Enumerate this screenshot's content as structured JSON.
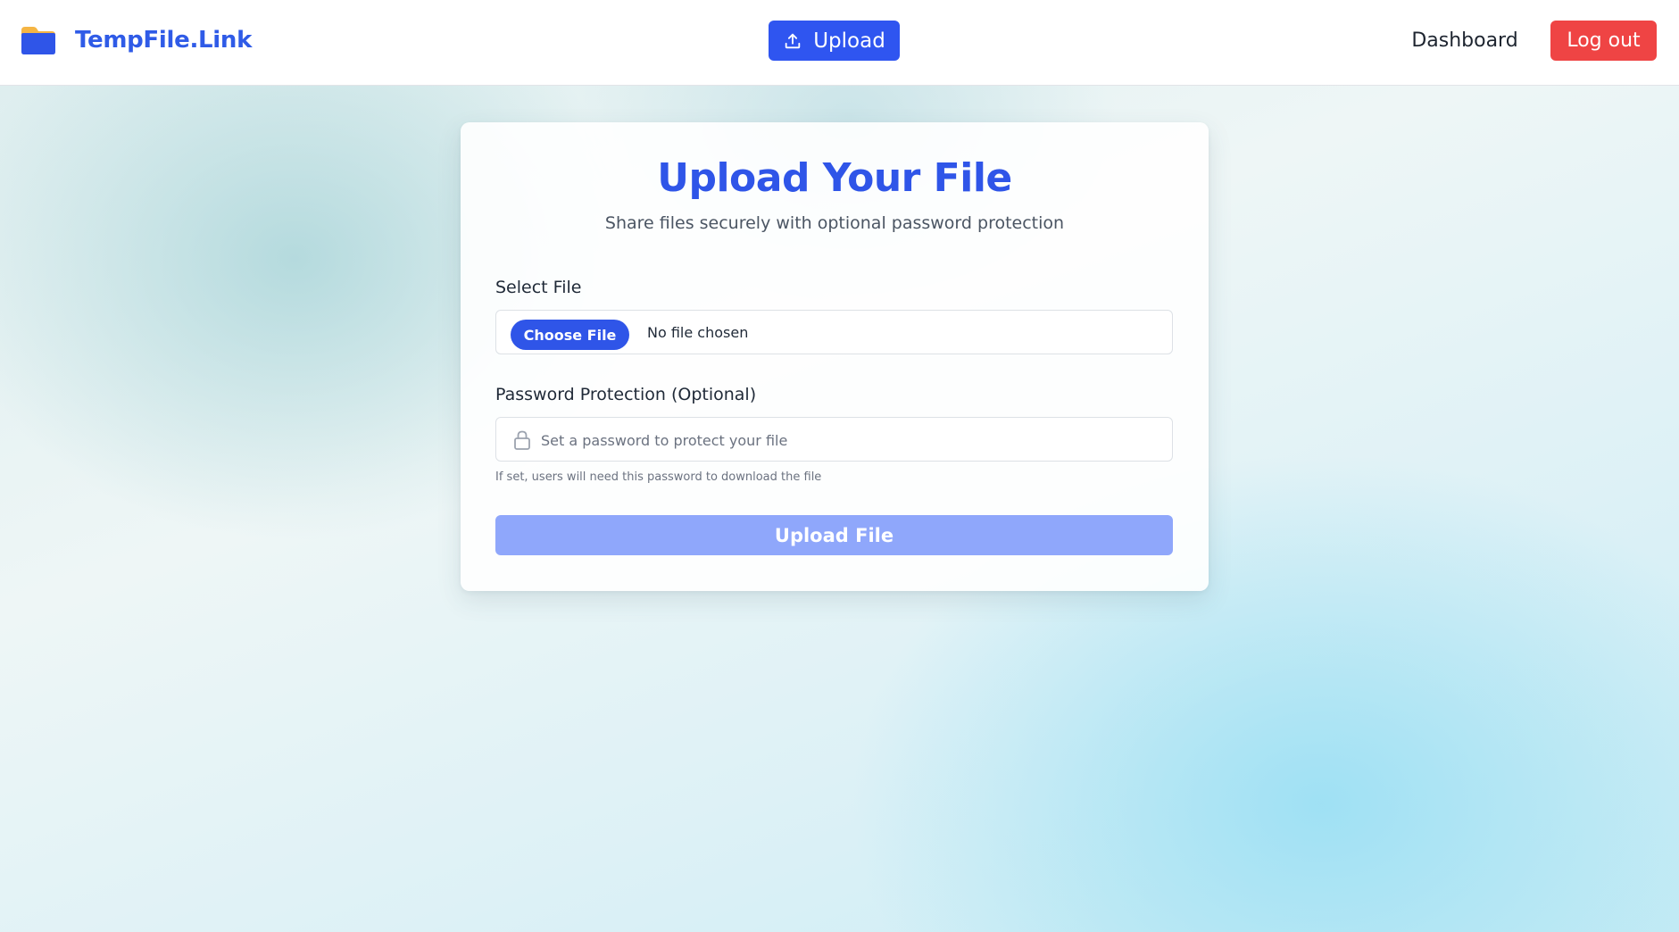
{
  "header": {
    "brand": {
      "name": "TempFile.Link",
      "icon": "folder-icon"
    },
    "upload_button": {
      "label": "Upload",
      "icon": "upload-icon"
    },
    "dashboard_link": "Dashboard",
    "logout_button": "Log out"
  },
  "card": {
    "title": "Upload Your File",
    "subtitle": "Share files securely with optional password protection",
    "file_section": {
      "label": "Select File",
      "choose_button": "Choose File",
      "status": "No file chosen"
    },
    "password_section": {
      "label": "Password Protection (Optional)",
      "icon": "lock-icon",
      "value": "",
      "placeholder": "Set a password to protect your file",
      "helper": "If set, users will need this password to download the file"
    },
    "submit_button": "Upload File"
  },
  "colors": {
    "brand_blue": "#2f55e8",
    "danger_red": "#ef4444",
    "disabled_blue": "#8fa7fb",
    "folder_orange": "#f5b544"
  }
}
